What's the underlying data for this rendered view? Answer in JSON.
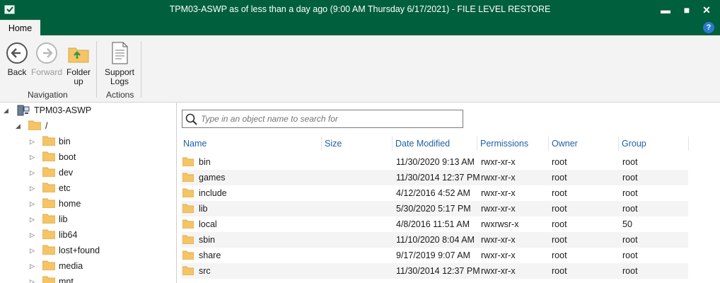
{
  "window": {
    "title": "TPM03-ASWP as of less than a day ago (9:00 AM Thursday 6/17/2021) - FILE LEVEL RESTORE",
    "minimize_glyph": "▬",
    "maximize_glyph": "■",
    "close_glyph": "✕"
  },
  "tabs": {
    "home": "Home",
    "help": "?"
  },
  "ribbon": {
    "back_line1": "Back",
    "forward_line1": "Forward",
    "folder_up_line1": "Folder",
    "folder_up_line2": "up",
    "support_line1": "Support",
    "support_line2": "Logs",
    "group_navigation": "Navigation",
    "group_actions": "Actions"
  },
  "tree": {
    "root": "TPM03-ASWP",
    "slash": "/",
    "children": [
      "bin",
      "boot",
      "dev",
      "etc",
      "home",
      "lib",
      "lib64",
      "lost+found",
      "media",
      "mnt"
    ]
  },
  "search": {
    "placeholder": "Type in an object name to search for"
  },
  "columns": {
    "name": "Name",
    "size": "Size",
    "date": "Date Modified",
    "permissions": "Permissions",
    "owner": "Owner",
    "group": "Group"
  },
  "files": [
    {
      "name": "bin",
      "size": "",
      "date": "11/30/2020 9:13 AM",
      "permissions": "rwxr-xr-x",
      "owner": "root",
      "group": "root"
    },
    {
      "name": "games",
      "size": "",
      "date": "11/30/2014 12:37 PM",
      "permissions": "rwxr-xr-x",
      "owner": "root",
      "group": "root"
    },
    {
      "name": "include",
      "size": "",
      "date": "4/12/2016 4:52 AM",
      "permissions": "rwxr-xr-x",
      "owner": "root",
      "group": "root"
    },
    {
      "name": "lib",
      "size": "",
      "date": "5/30/2020 5:17 PM",
      "permissions": "rwxr-xr-x",
      "owner": "root",
      "group": "root"
    },
    {
      "name": "local",
      "size": "",
      "date": "4/8/2016 11:51 AM",
      "permissions": "rwxrwsr-x",
      "owner": "root",
      "group": "50"
    },
    {
      "name": "sbin",
      "size": "",
      "date": "11/10/2020 8:04 AM",
      "permissions": "rwxr-xr-x",
      "owner": "root",
      "group": "root"
    },
    {
      "name": "share",
      "size": "",
      "date": "9/17/2019 9:07 AM",
      "permissions": "rwxr-xr-x",
      "owner": "root",
      "group": "root"
    },
    {
      "name": "src",
      "size": "",
      "date": "11/30/2014 12:37 PM",
      "permissions": "rwxr-xr-x",
      "owner": "root",
      "group": "root"
    }
  ],
  "colors": {
    "titlebar": "#005f3d",
    "header_text": "#1f5fa8",
    "folder": "#f5c467",
    "ribbon_bg": "#f3f3f3"
  },
  "icons": [
    "app-icon",
    "back-arrow-icon",
    "forward-arrow-icon",
    "folder-up-icon",
    "support-logs-icon",
    "computer-icon",
    "folder-icon",
    "search-icon",
    "help-icon"
  ]
}
